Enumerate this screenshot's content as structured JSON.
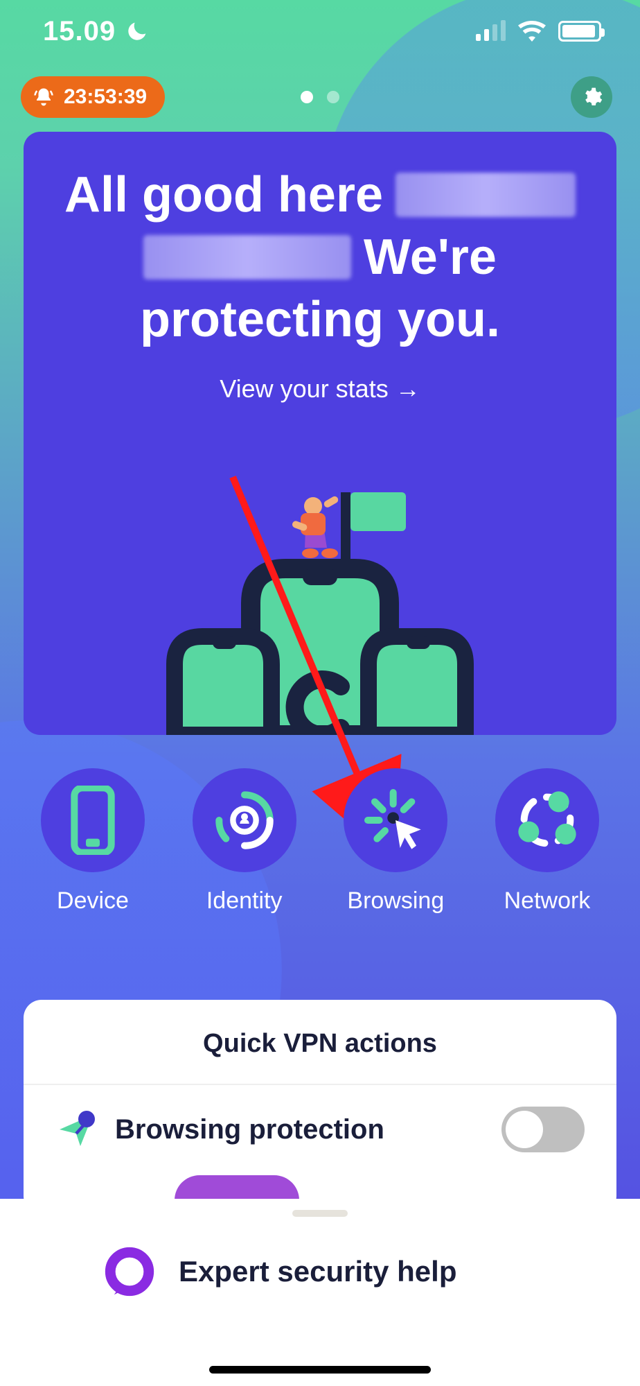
{
  "statusbar": {
    "time": "15.09"
  },
  "top": {
    "alert_timer": "23:53:39"
  },
  "hero": {
    "line1_text": "All good here",
    "line2_text": "We're",
    "line3_text": "protecting you.",
    "stats_link": "View your stats →"
  },
  "tiles": [
    {
      "label": "Device"
    },
    {
      "label": "Identity"
    },
    {
      "label": "Browsing"
    },
    {
      "label": "Network"
    }
  ],
  "vpn": {
    "title": "Quick VPN actions",
    "row1_label": "Browsing protection"
  },
  "help": {
    "label": "Expert security help"
  },
  "colors": {
    "primary": "#4e3fe0",
    "accent": "#57d9a3",
    "alert": "#ec6a19",
    "purple": "#a04bd8"
  }
}
